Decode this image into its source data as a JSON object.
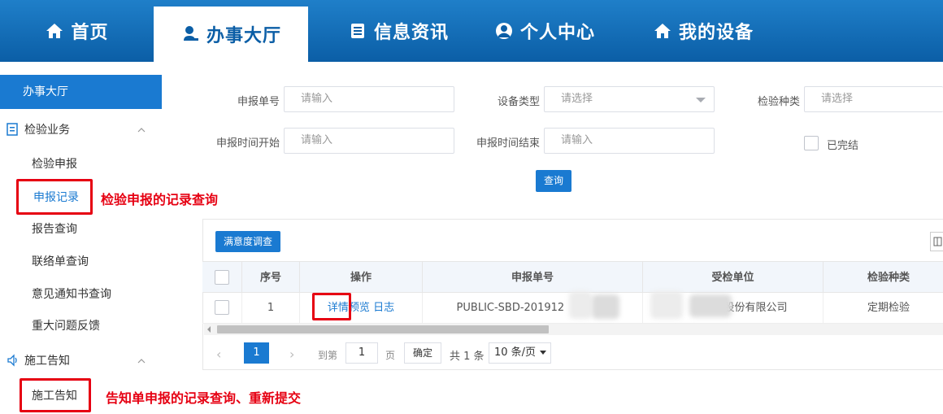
{
  "nav": {
    "items": [
      {
        "label": "首页",
        "icon": "home-icon"
      },
      {
        "label": "办事大厅",
        "icon": "person-stamp-icon"
      },
      {
        "label": "信息资讯",
        "icon": "news-icon"
      },
      {
        "label": "个人中心",
        "icon": "user-circle-icon"
      },
      {
        "label": "我的设备",
        "icon": "home-icon"
      }
    ],
    "active": "办事大厅"
  },
  "sidebar": {
    "header": "办事大厅",
    "groups": [
      {
        "label": "检验业务",
        "icon": "document-icon",
        "items": [
          "检验申报",
          "申报记录",
          "报告查询",
          "联络单查询",
          "意见通知书查询",
          "重大问题反馈"
        ]
      },
      {
        "label": "施工告知",
        "icon": "speaker-icon",
        "items": [
          "施工告知"
        ]
      }
    ],
    "active_item": "申报记录"
  },
  "annotations": {
    "record_query": "检验申报的记录查询",
    "notice_query": "告知单申报的记录查询、重新提交"
  },
  "filters": {
    "report_no": {
      "label": "申报单号",
      "placeholder": "请输入"
    },
    "device_type": {
      "label": "设备类型",
      "placeholder": "请选择"
    },
    "inspect_type": {
      "label": "检验种类",
      "placeholder": "请选择"
    },
    "time_start": {
      "label": "申报时间开始",
      "placeholder": "请输入"
    },
    "time_end": {
      "label": "申报时间结束",
      "placeholder": "请输入"
    },
    "completed": {
      "label": "已完结"
    },
    "search_button": "查询"
  },
  "table": {
    "toolbar_button": "满意度调查",
    "columns": [
      "序号",
      "操作",
      "申报单号",
      "受检单位",
      "检验种类"
    ],
    "rows": [
      {
        "index": "1",
        "actions": [
          "详情",
          "预览",
          "日志"
        ],
        "report_no_prefix": "PUBLIC-SBD-201912",
        "report_no_suffix": "6",
        "unit_suffix": "股份有限公司",
        "inspect_type": "定期检验"
      }
    ]
  },
  "pagination": {
    "current_page": "1",
    "goto_label": "到第",
    "goto_value": "1",
    "page_label": "页",
    "confirm": "确定",
    "total": "共 1 条",
    "page_size": "10 条/页"
  },
  "colors": {
    "nav_bg": "#0b5ea6",
    "accent": "#1a7ad1",
    "annotation": "#e60012"
  }
}
